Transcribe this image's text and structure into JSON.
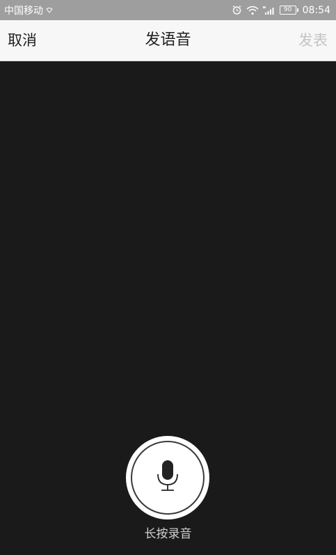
{
  "status_bar": {
    "carrier": "中国移动",
    "battery_level": "90",
    "time": "08:54",
    "icons": [
      "signal-small-icon",
      "alarm-icon",
      "wifi-icon",
      "cellular-4g-icon",
      "battery-icon"
    ]
  },
  "nav": {
    "cancel_label": "取消",
    "title": "发语音",
    "publish_label": "发表"
  },
  "record": {
    "icon": "microphone-icon",
    "hint": "长按录音"
  },
  "colors": {
    "status_bar_bg": "#9e9e9e",
    "nav_bg": "#f7f7f7",
    "content_bg": "#1a1a1a",
    "publish_disabled": "#c4c4c4"
  }
}
